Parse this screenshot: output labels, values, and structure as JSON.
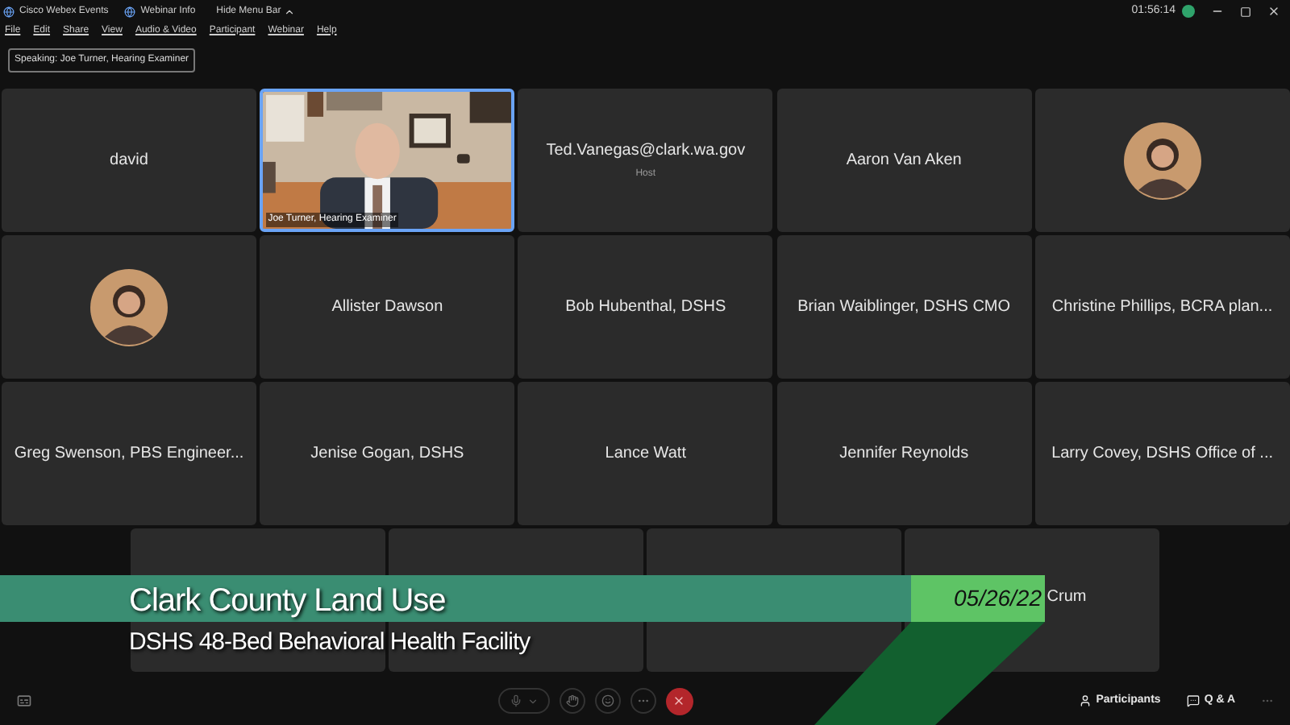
{
  "title_bar": {
    "tabs": [
      {
        "label": "Cisco Webex Events"
      },
      {
        "label": "Webinar Info"
      }
    ],
    "hide_menu": "Hide Menu Bar",
    "timer": "01:56:14"
  },
  "menu": [
    "File",
    "Edit",
    "Share",
    "View",
    "Audio & Video",
    "Participant",
    "Webinar",
    "Help"
  ],
  "speaking": "Speaking: Joe Turner, Hearing Examiner",
  "tiles": [
    {
      "kind": "name",
      "name": "david",
      "speaking": false
    },
    {
      "kind": "video",
      "name": "Joe Turner, Hearing Examiner",
      "speaking": true
    },
    {
      "kind": "name",
      "name": "Ted.Vanegas@clark.wa.gov",
      "role": "Host",
      "speaking": false
    },
    {
      "kind": "name",
      "name": "Aaron Van Aken",
      "speaking": false
    },
    {
      "kind": "avatar",
      "speaking": false
    },
    {
      "kind": "avatar",
      "speaking": false
    },
    {
      "kind": "name",
      "name": "Allister Dawson",
      "speaking": false
    },
    {
      "kind": "name",
      "name": "Bob Hubenthal, DSHS",
      "speaking": false
    },
    {
      "kind": "name",
      "name": "Brian Waiblinger, DSHS CMO",
      "speaking": false
    },
    {
      "kind": "name",
      "name": "Christine Phillips, BCRA plan...",
      "speaking": false
    },
    {
      "kind": "name",
      "name": "Greg Swenson, PBS Engineer...",
      "speaking": false
    },
    {
      "kind": "name",
      "name": "Jenise Gogan, DSHS",
      "speaking": false
    },
    {
      "kind": "name",
      "name": "Lance Watt",
      "speaking": false
    },
    {
      "kind": "name",
      "name": "Jennifer Reynolds",
      "speaking": false
    },
    {
      "kind": "name",
      "name": "Larry Covey, DSHS Office of ...",
      "speaking": false
    },
    {
      "kind": "blank",
      "speaking": false
    },
    {
      "kind": "blank",
      "speaking": false
    },
    {
      "kind": "blank",
      "speaking": false
    },
    {
      "kind": "covered_name",
      "name": "Crum",
      "speaking": false
    }
  ],
  "banner": {
    "title": "Clark County Land Use",
    "subtitle": "DSHS 48-Bed Behavioral Health Facility",
    "date": "05/26/22"
  },
  "bottom_bar": {
    "buttons": [
      "Participants",
      "Q & A"
    ]
  }
}
